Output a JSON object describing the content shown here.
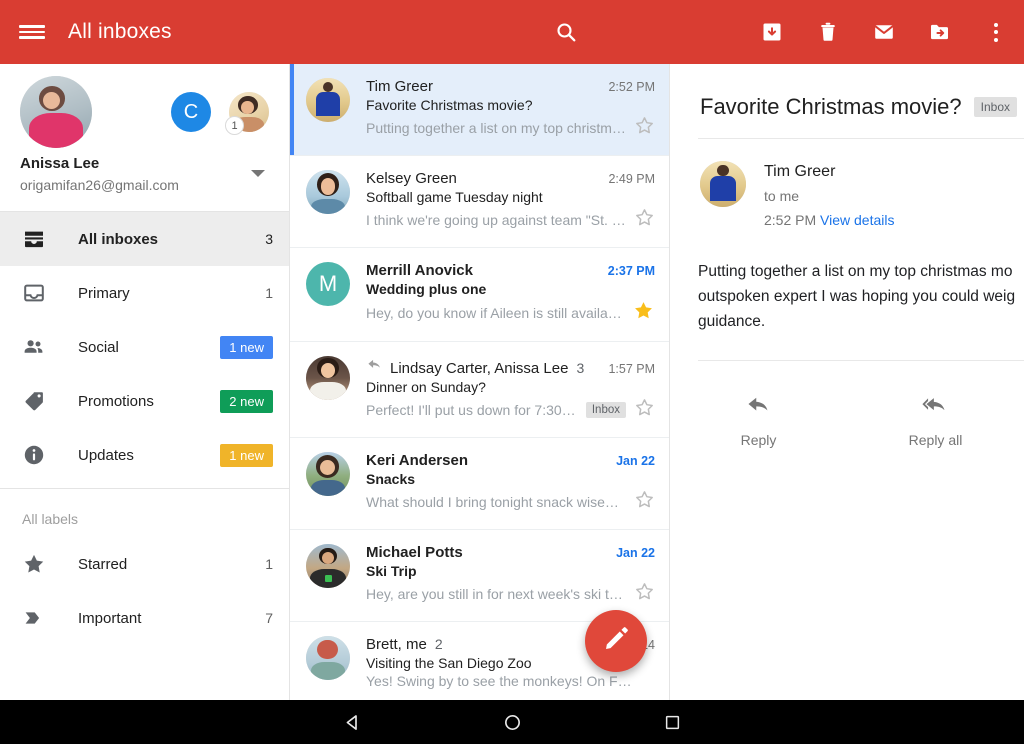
{
  "appbar": {
    "title": "All inboxes",
    "menu_icon": "hamburger-menu-icon",
    "search_icon": "search-icon",
    "archive_icon": "archive-icon",
    "delete_icon": "delete-trash-icon",
    "mail_icon": "mark-unread-envelope-icon",
    "move_icon": "move-to-folder-icon",
    "overflow_icon": "overflow-menu-icon",
    "bg": "#D93D32"
  },
  "sidebar": {
    "account": {
      "name": "Anissa Lee",
      "email": "origamifan26@gmail.com",
      "avatar_main": "user-photo-avatar",
      "avatar_alt_letter": "C",
      "avatar_alt_letter_color": "#1E88E5",
      "avatar_alt_photo": "user-photo-avatar",
      "avatar_alt_photo_badge": "1",
      "expand_icon": "chevron-down-icon"
    },
    "items": [
      {
        "label": "All inboxes",
        "icon": "all-inboxes-icon",
        "count": "3",
        "selected": true,
        "badge": null
      },
      {
        "label": "Primary",
        "icon": "inbox-icon",
        "count": "1",
        "selected": false,
        "badge": null
      },
      {
        "label": "Social",
        "icon": "people-icon",
        "count": null,
        "selected": false,
        "badge": {
          "text": "1 new",
          "color": "#4285F4"
        }
      },
      {
        "label": "Promotions",
        "icon": "tag-icon",
        "count": null,
        "selected": false,
        "badge": {
          "text": "2 new",
          "color": "#0F9D58"
        }
      },
      {
        "label": "Updates",
        "icon": "info-icon",
        "count": null,
        "selected": false,
        "badge": {
          "text": "1 new",
          "color": "#F0B429"
        }
      }
    ],
    "labels_section_title": "All labels",
    "labels": [
      {
        "label": "Starred",
        "icon": "star-icon",
        "count": "1"
      },
      {
        "label": "Important",
        "icon": "important-icon",
        "count": "7"
      }
    ]
  },
  "maillist": {
    "compose_fab_icon": "compose-pencil-icon",
    "compose_fab_color": "#E0483A",
    "emails": [
      {
        "sender": "Tim Greer",
        "subject": "Favorite Christmas movie?",
        "snippet": "Putting together a list on my top christmas…",
        "time": "2:52 PM",
        "unread": false,
        "selected": true,
        "starred": false,
        "count": null,
        "chip": null,
        "has_reply_icon": false,
        "avatar_type": "photo",
        "avatar_letter": null,
        "avatar_color": "#C9A227"
      },
      {
        "sender": "Kelsey Green",
        "subject": "Softball game Tuesday night",
        "snippet": "I think we're going up against team \"St. El…",
        "time": "2:49 PM",
        "unread": false,
        "selected": false,
        "starred": false,
        "count": null,
        "chip": null,
        "has_reply_icon": false,
        "avatar_type": "photo",
        "avatar_letter": null,
        "avatar_color": "#7FA8B8"
      },
      {
        "sender": "Merrill Anovick",
        "subject": "Wedding plus one",
        "snippet": "Hey, do you know if Aileen is still available…",
        "time": "2:37 PM",
        "unread": true,
        "selected": false,
        "starred": true,
        "count": null,
        "chip": null,
        "has_reply_icon": false,
        "avatar_type": "letter",
        "avatar_letter": "M",
        "avatar_color": "#4DB6AC"
      },
      {
        "sender": "Lindsay Carter, Anissa Lee",
        "subject": "Dinner on Sunday?",
        "snippet": "Perfect! I'll put us down for 7:30pm.…",
        "time": "1:57 PM",
        "unread": false,
        "selected": false,
        "starred": false,
        "count": "3",
        "chip": "Inbox",
        "has_reply_icon": true,
        "avatar_type": "photo",
        "avatar_letter": null,
        "avatar_color": "#A9836B"
      },
      {
        "sender": "Keri Andersen",
        "subject": "Snacks",
        "snippet": "What should I bring tonight snack wise? I t…",
        "time": "Jan 22",
        "unread": true,
        "selected": false,
        "starred": false,
        "count": null,
        "chip": null,
        "has_reply_icon": false,
        "avatar_type": "photo",
        "avatar_letter": null,
        "avatar_color": "#8BA870"
      },
      {
        "sender": "Michael Potts",
        "subject": "Ski Trip",
        "snippet": "Hey, are you still in for next week's ski trip?…",
        "time": "Jan 22",
        "unread": true,
        "selected": false,
        "starred": false,
        "count": null,
        "chip": null,
        "has_reply_icon": false,
        "avatar_type": "photo",
        "avatar_letter": null,
        "avatar_color": "#8C7B6B"
      },
      {
        "sender": "Brett, me",
        "subject": "Visiting the San Diego Zoo",
        "snippet": "Yes! Swing by to see the monkeys! On F…",
        "time": "8/29/2014",
        "unread": false,
        "selected": false,
        "starred": false,
        "count": "2",
        "chip": null,
        "has_reply_icon": false,
        "avatar_type": "photo",
        "avatar_letter": null,
        "avatar_color": "#B8746A"
      }
    ]
  },
  "reader": {
    "subject": "Favorite Christmas movie?",
    "label_chip": "Inbox",
    "sender": "Tim Greer",
    "recipient": "to me",
    "time": "2:52 PM",
    "details_link": "View details",
    "body_lines": [
      "Putting together a list on my top christmas mo",
      "outspoken expert I was hoping you could weig",
      "guidance."
    ],
    "actions": [
      {
        "label": "Reply",
        "icon": "reply-arrow-icon"
      },
      {
        "label": "Reply all",
        "icon": "reply-all-arrow-icon"
      }
    ]
  },
  "navbar": {
    "back_icon": "android-back-triangle-icon",
    "home_icon": "android-home-circle-icon",
    "recents_icon": "android-recents-square-icon"
  }
}
